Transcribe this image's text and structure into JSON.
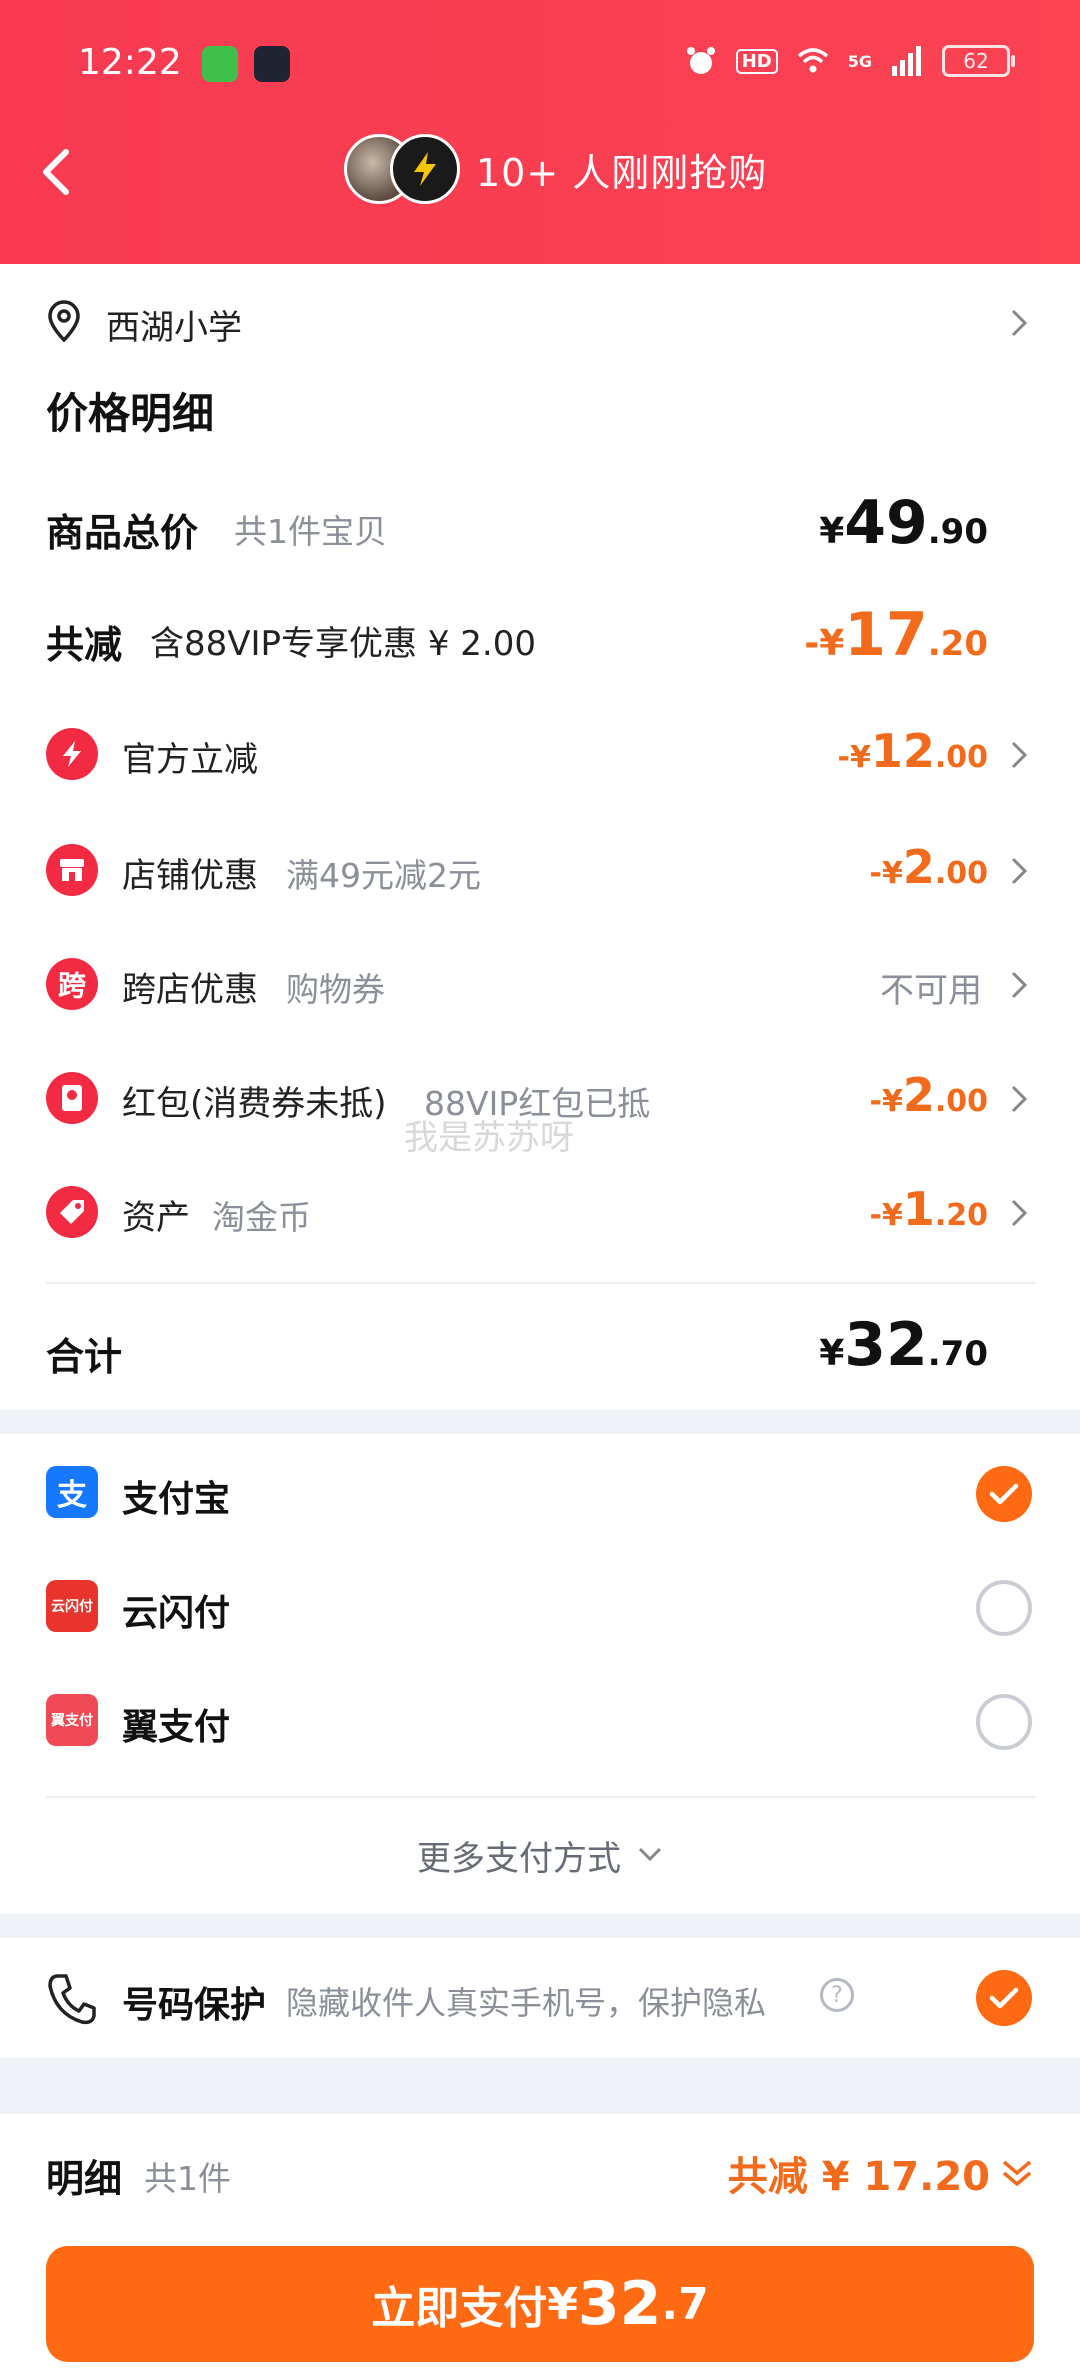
{
  "status_bar": {
    "time": "12:22",
    "battery": "62",
    "network": "5G",
    "hd": "HD"
  },
  "header": {
    "title": "10+ 人刚刚抢购",
    "back_icon": "back-arrow-icon"
  },
  "address": {
    "text": "西湖小学"
  },
  "price_detail": {
    "heading": "价格明细",
    "total": {
      "label": "商品总价",
      "sub": "共1件宝贝",
      "cur": "¥",
      "int": "49",
      "dec": ".90"
    },
    "reduce": {
      "label": "共减",
      "sub": "含88VIP专享优惠 ¥ 2.00",
      "cur": "-¥",
      "int": "17",
      "dec": ".20"
    },
    "items": [
      {
        "icon": "lightning-icon",
        "label": "官方立减",
        "sub": "",
        "cur": "-¥",
        "int": "12",
        "dec": ".00"
      },
      {
        "icon": "store-icon",
        "label": "店铺优惠",
        "sub": "满49元减2元",
        "cur": "-¥",
        "int": "2",
        "dec": ".00"
      },
      {
        "icon": "cross-store-icon",
        "icon_char": "跨",
        "label": "跨店优惠",
        "sub": "购物券",
        "status": "不可用"
      },
      {
        "icon": "red-packet-icon",
        "label": "红包(消费券未抵)",
        "sub": "88VIP红包已抵",
        "cur": "-¥",
        "int": "2",
        "dec": ".00"
      },
      {
        "icon": "tag-icon",
        "label": "资产",
        "sub": "淘金币",
        "cur": "-¥",
        "int": "1",
        "dec": ".20"
      }
    ],
    "sum": {
      "label": "合计",
      "cur": "¥",
      "int": "32",
      "dec": ".70"
    }
  },
  "watermark": "我是苏苏呀",
  "payment": {
    "methods": [
      {
        "name": "支付宝",
        "icon": "alipay-icon",
        "icon_char": "支",
        "color": "#1677ff",
        "selected": true
      },
      {
        "name": "云闪付",
        "icon": "unionpay-icon",
        "icon_char": "云闪付",
        "color": "#e8342c",
        "selected": false
      },
      {
        "name": "翼支付",
        "icon": "bestpay-icon",
        "icon_char": "翼支付",
        "color": "#f04a55",
        "selected": false
      }
    ],
    "more": "更多支付方式"
  },
  "privacy": {
    "label": "号码保护",
    "desc": "隐藏收件人真实手机号，保护隐私",
    "checked": true
  },
  "footer": {
    "detail_label": "明细",
    "detail_count": "共1件",
    "reduce_label": "共减 ¥ 17.20",
    "pay_label": "立即支付",
    "pay_cur": "¥",
    "pay_int": "32",
    "pay_dec": ".7"
  },
  "colors": {
    "accent": "#ff6a13",
    "header": "#f73a52",
    "discount": "#f26b1d"
  }
}
